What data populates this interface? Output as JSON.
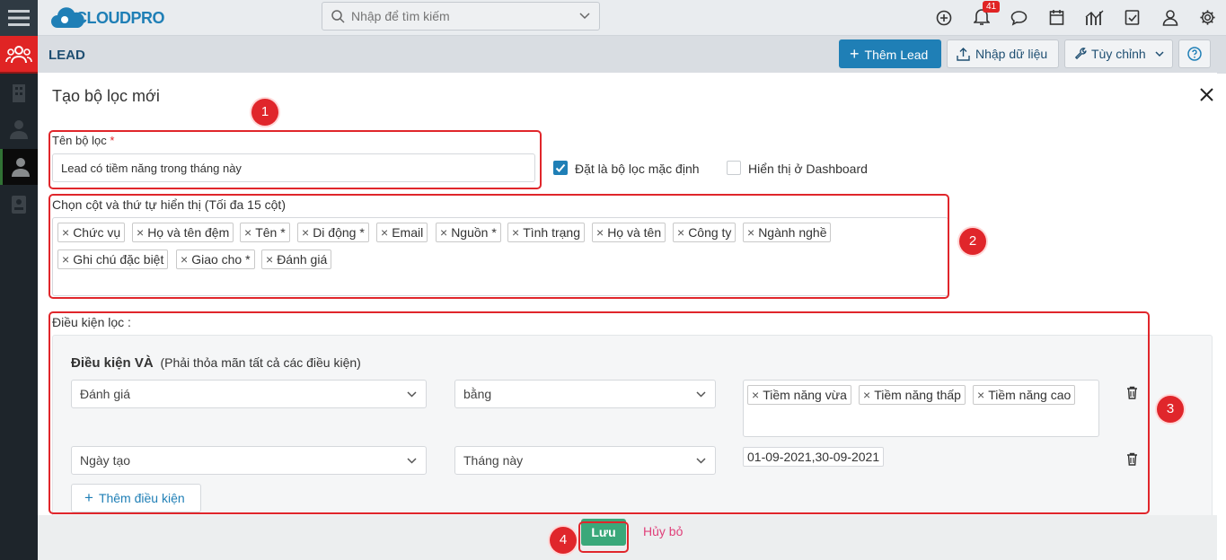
{
  "app": {
    "logo": "CLOUDPRO",
    "search_placeholder": "Nhập để tìm kiếm",
    "notification_count": "41"
  },
  "page": {
    "title": "LEAD",
    "add_button": "Thêm Lead",
    "import_button": "Nhập dữ liệu",
    "customize_button": "Tùy chỉnh"
  },
  "modal": {
    "title": "Tạo bộ lọc mới",
    "filter_name_label": "Tên bộ lọc",
    "required_mark": "*",
    "filter_name_value": "Lead có tiềm năng trong tháng này",
    "default_filter_label": "Đặt là bộ lọc mặc định",
    "default_filter_checked": true,
    "dashboard_label": "Hiển thị ở Dashboard",
    "dashboard_checked": false,
    "columns_label": "Chọn cột và thứ tự hiển thị (Tối đa 15 cột)",
    "columns": [
      "Chức vụ",
      "Họ và tên đệm",
      "Tên *",
      "Di động *",
      "Email",
      "Nguồn *",
      "Tình trạng",
      "Họ và tên",
      "Công ty",
      "Ngành nghề",
      "Ghi chú đặc biệt",
      "Giao cho *",
      "Đánh giá"
    ],
    "conditions_label": "Điều kiện lọc :",
    "and_title": "Điều kiện VÀ",
    "and_subtitle": "(Phải thỏa mãn tất cả các điều kiện)",
    "conditions": [
      {
        "field": "Đánh giá",
        "operator": "bằng",
        "values": [
          "Tiềm năng vừa",
          "Tiềm năng thấp",
          "Tiềm năng cao"
        ]
      },
      {
        "field": "Ngày tạo",
        "operator": "Tháng này",
        "value_text": "01-09-2021,30-09-2021"
      }
    ],
    "add_condition": "Thêm điều kiện",
    "save": "Lưu",
    "cancel": "Hủy bỏ"
  },
  "annotations": [
    "1",
    "2",
    "3",
    "4"
  ],
  "colors": {
    "primary": "#1f7fb6",
    "save": "#3aa87a",
    "annotation": "#e0262b",
    "rail": "#2f3a43",
    "rail_active": "#e02424",
    "cancel": "#e0407a"
  }
}
